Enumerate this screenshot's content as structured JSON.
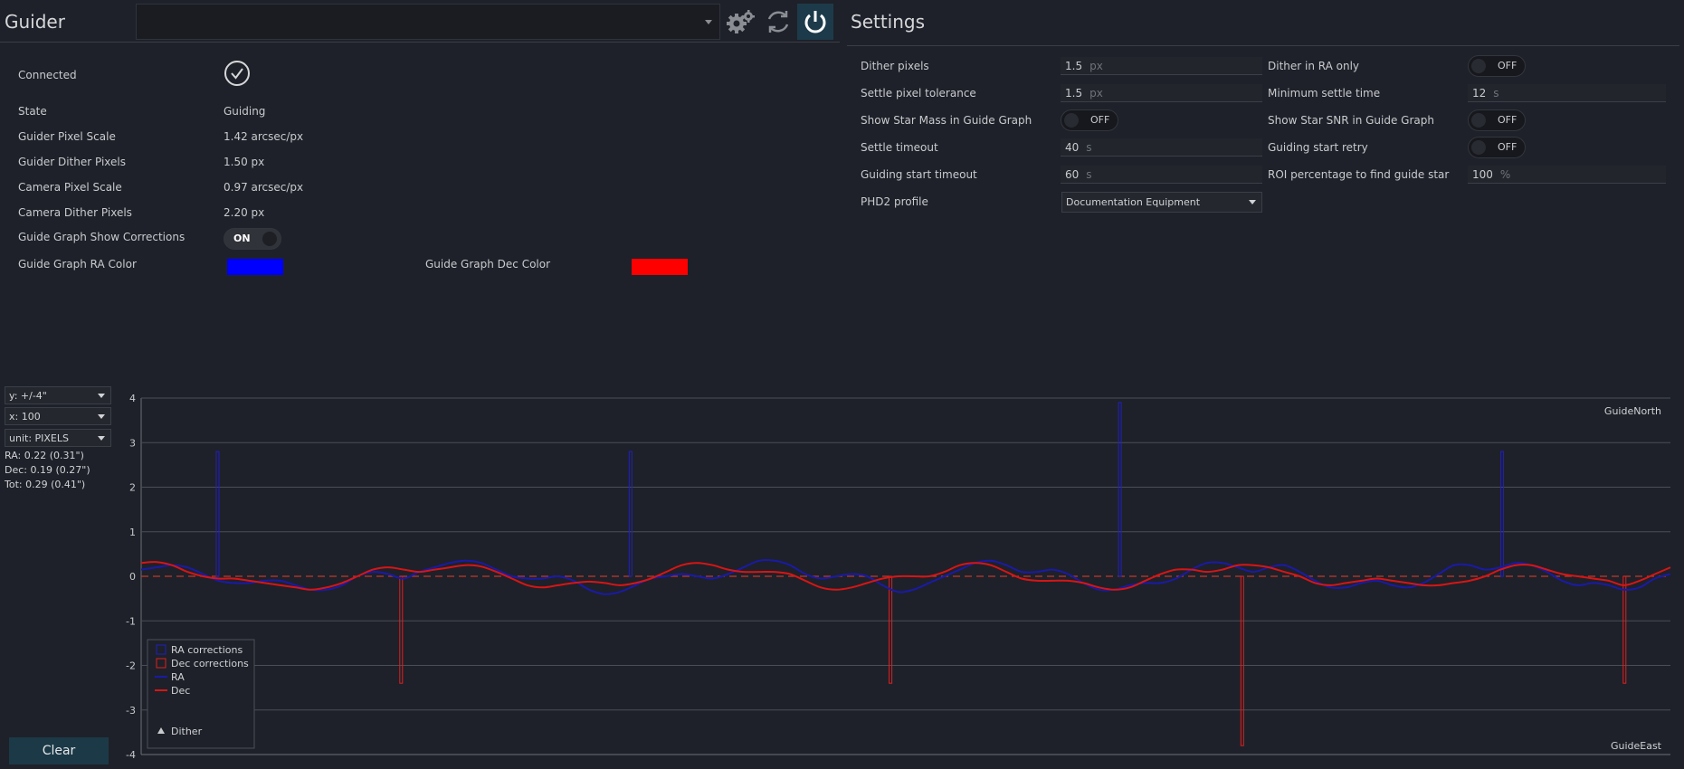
{
  "guider": {
    "title": "Guider",
    "device_value": "",
    "rows": [
      {
        "label": "State",
        "value": "Guiding"
      },
      {
        "label": "Guider Pixel Scale",
        "value": "1.42 arcsec/px"
      },
      {
        "label": "Guider Dither Pixels",
        "value": "1.50 px"
      },
      {
        "label": "Camera Pixel Scale",
        "value": "0.97 arcsec/px"
      },
      {
        "label": "Camera Dither Pixels",
        "value": "2.20 px"
      }
    ],
    "connected_label": "Connected",
    "show_corrections_label": "Guide Graph Show Corrections",
    "show_corrections_state": "ON",
    "ra_color_label": "Guide Graph RA Color",
    "ra_color": "#0000ff",
    "dec_color_label": "Guide Graph Dec Color",
    "dec_color": "#ff0000"
  },
  "icons": {
    "settings": "gears-icon",
    "refresh": "refresh-icon",
    "power": "power-icon",
    "connected": "check-circle-icon"
  },
  "settings": {
    "title": "Settings",
    "left": [
      {
        "label": "Dither pixels",
        "value": "1.5",
        "unit": "px"
      },
      {
        "label": "Settle pixel tolerance",
        "value": "1.5",
        "unit": "px"
      },
      {
        "label": "Show Star Mass in Guide Graph",
        "toggle": "OFF"
      },
      {
        "label": "Settle timeout",
        "value": "40",
        "unit": "s"
      },
      {
        "label": "Guiding start timeout",
        "value": "60",
        "unit": "s"
      },
      {
        "label": "PHD2 profile",
        "select": "Documentation Equipment"
      }
    ],
    "right": [
      {
        "label": "Dither in RA only",
        "toggle": "OFF"
      },
      {
        "label": "Minimum settle time",
        "value": "12",
        "unit": "s"
      },
      {
        "label": "Show Star SNR in Guide Graph",
        "toggle": "OFF"
      },
      {
        "label": "Guiding start retry",
        "toggle": "OFF"
      },
      {
        "label": "ROI percentage to find guide star",
        "value": "100",
        "unit": "%"
      }
    ]
  },
  "graph_controls": {
    "y_scale": "y: +/-4\"",
    "x_scale": "x: 100",
    "unit": "unit: PIXELS",
    "rms_ra": "RA: 0.22 (0.31\")",
    "rms_dec": "Dec: 0.19 (0.27\")",
    "rms_tot": "Tot: 0.29 (0.41\")",
    "clear_label": "Clear"
  },
  "chart_data": {
    "type": "line",
    "ylim": [
      -4,
      4
    ],
    "xlim": [
      0,
      100
    ],
    "yticks": [
      "4",
      "3",
      "2",
      "1",
      "0",
      "-1",
      "-2",
      "-3",
      "-4"
    ],
    "corner_top_right": "GuideNorth",
    "corner_bottom_right": "GuideEast",
    "legend": [
      "RA corrections",
      "Dec corrections",
      "RA",
      "Dec",
      "Dither"
    ],
    "colors": {
      "ra": "#1a1aa8",
      "dec": "#d81515",
      "grid": "#4a4e56",
      "zero": "#c0392b"
    },
    "series": [
      {
        "name": "RA",
        "values": [
          0.15,
          0.2,
          0.25,
          0.2,
          0.05,
          -0.1,
          -0.15,
          -0.15,
          -0.1,
          -0.1,
          -0.2,
          -0.3,
          -0.3,
          -0.2,
          0.0,
          0.1,
          0.05,
          -0.05,
          0.1,
          0.2,
          0.3,
          0.35,
          0.3,
          0.15,
          0.0,
          -0.05,
          -0.05,
          0.0,
          -0.1,
          -0.3,
          -0.4,
          -0.35,
          -0.2,
          -0.05,
          0.0,
          0.05,
          0.0,
          -0.05,
          0.05,
          0.2,
          0.35,
          0.35,
          0.25,
          0.05,
          -0.05,
          0.0,
          0.05,
          0.0,
          -0.2,
          -0.35,
          -0.3,
          -0.15,
          0.0,
          0.15,
          0.3,
          0.35,
          0.25,
          0.1,
          0.1,
          0.15,
          0.05,
          -0.15,
          -0.3,
          -0.3,
          -0.2,
          -0.15,
          -0.15,
          -0.05,
          0.15,
          0.3,
          0.3,
          0.2,
          0.1,
          0.2,
          0.25,
          0.1,
          -0.1,
          -0.25,
          -0.25,
          -0.15,
          -0.1,
          -0.2,
          -0.25,
          -0.15,
          0.05,
          0.25,
          0.25,
          0.15,
          0.2,
          0.3,
          0.25,
          0.1,
          -0.1,
          -0.2,
          -0.15,
          -0.2,
          -0.3,
          -0.25,
          -0.05,
          0.05
        ]
      },
      {
        "name": "Dec",
        "values": [
          0.3,
          0.32,
          0.25,
          0.1,
          0.0,
          -0.05,
          -0.05,
          -0.1,
          -0.15,
          -0.2,
          -0.25,
          -0.3,
          -0.25,
          -0.15,
          0.0,
          0.15,
          0.2,
          0.15,
          0.1,
          0.15,
          0.2,
          0.25,
          0.22,
          0.1,
          -0.05,
          -0.2,
          -0.25,
          -0.2,
          -0.15,
          -0.12,
          -0.15,
          -0.2,
          -0.15,
          -0.05,
          0.1,
          0.25,
          0.3,
          0.25,
          0.15,
          0.1,
          0.1,
          0.1,
          0.05,
          -0.1,
          -0.25,
          -0.3,
          -0.25,
          -0.15,
          -0.05,
          0.0,
          0.0,
          0.0,
          0.1,
          0.25,
          0.3,
          0.25,
          0.1,
          -0.05,
          -0.1,
          -0.1,
          -0.1,
          -0.15,
          -0.25,
          -0.3,
          -0.25,
          -0.1,
          0.05,
          0.15,
          0.15,
          0.1,
          0.15,
          0.25,
          0.25,
          0.2,
          0.1,
          0.0,
          -0.15,
          -0.2,
          -0.15,
          -0.1,
          -0.05,
          -0.1,
          -0.15,
          -0.2,
          -0.2,
          -0.15,
          -0.1,
          0.0,
          0.15,
          0.25,
          0.25,
          0.15,
          0.05,
          0.0,
          -0.05,
          -0.1,
          -0.2,
          -0.1,
          0.05,
          0.2
        ]
      },
      {
        "name": "RA corrections",
        "points": [
          {
            "x": 5,
            "y": 2.8
          },
          {
            "x": 32,
            "y": 2.8
          },
          {
            "x": 64,
            "y": 3.9
          },
          {
            "x": 89,
            "y": 2.8
          }
        ]
      },
      {
        "name": "Dec corrections",
        "points": [
          {
            "x": 17,
            "y": -2.4
          },
          {
            "x": 49,
            "y": -2.4
          },
          {
            "x": 72,
            "y": -3.8
          },
          {
            "x": 97,
            "y": -2.4
          }
        ]
      }
    ]
  }
}
